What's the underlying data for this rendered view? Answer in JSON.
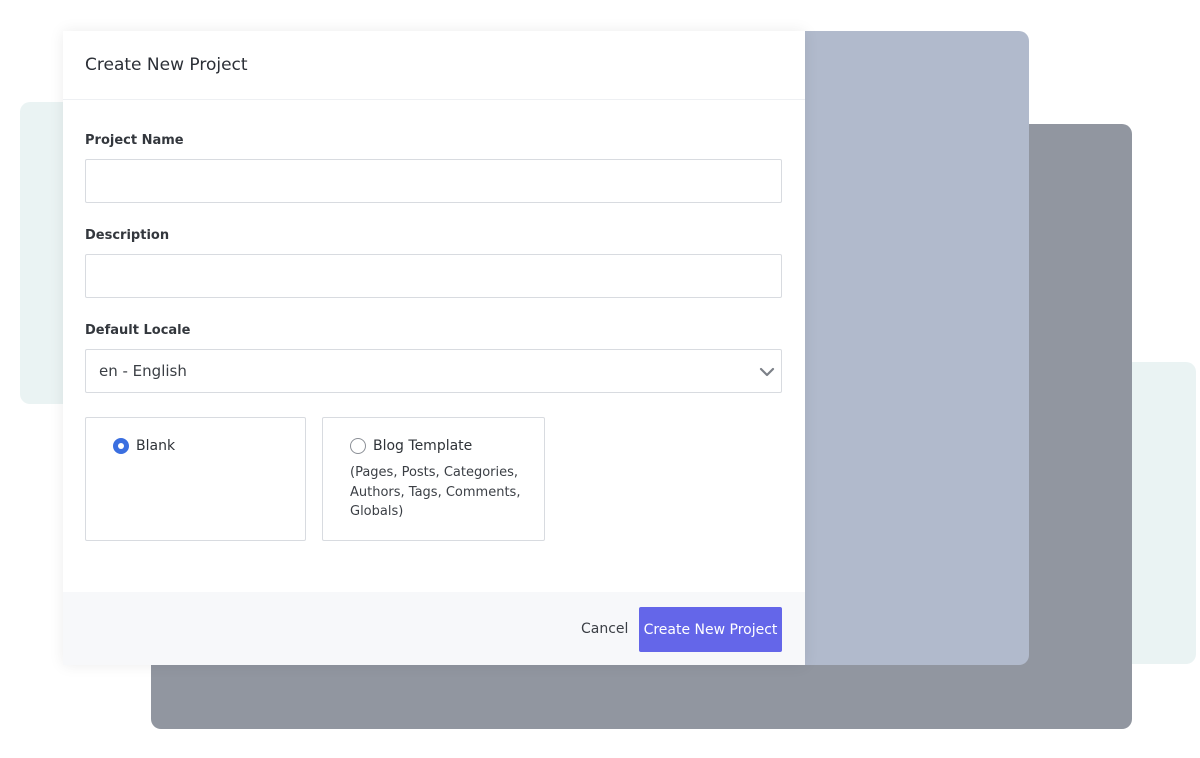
{
  "modal": {
    "title": "Create New Project"
  },
  "form": {
    "project_name": {
      "label": "Project Name",
      "value": "",
      "placeholder": ""
    },
    "description": {
      "label": "Description",
      "value": "",
      "placeholder": ""
    },
    "default_locale": {
      "label": "Default Locale",
      "selected": "en - English"
    }
  },
  "templates": [
    {
      "title": "Blank",
      "selected": true,
      "description": ""
    },
    {
      "title": "Blog Template",
      "selected": false,
      "description": "(Pages, Posts, Categories, Authors, Tags, Comments, Globals)"
    }
  ],
  "footer": {
    "cancel_label": "Cancel",
    "create_label": "Create New Project"
  },
  "colors": {
    "primary_button": "#6466e9",
    "radio_selected": "#3b6fe0",
    "backdrop_blue": "#b1bacc",
    "backdrop_gray": "#9196a0",
    "backdrop_mint": "#eaf3f3"
  },
  "icons": {
    "select_chevron": "chevron-down-icon"
  }
}
